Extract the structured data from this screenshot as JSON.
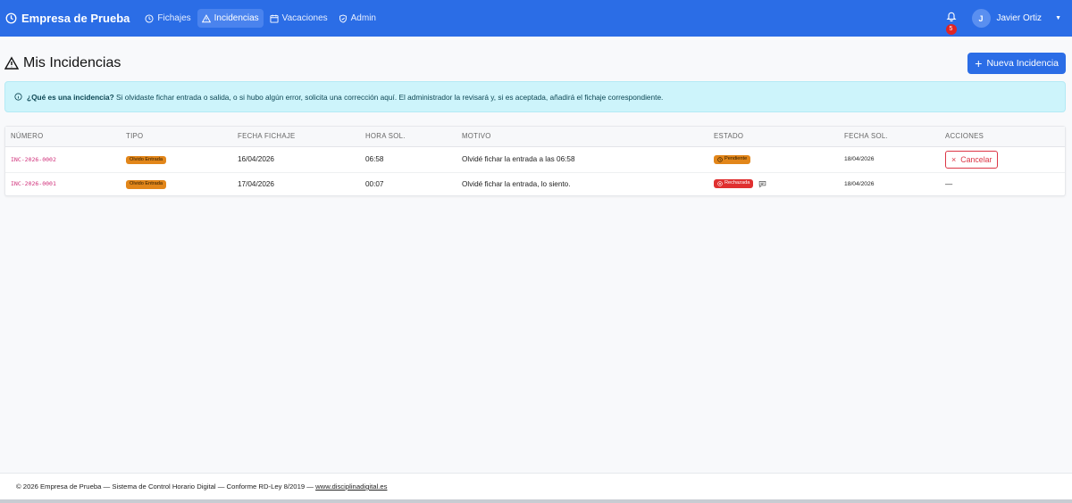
{
  "navbar": {
    "brand": "Empresa de Prueba",
    "items": [
      {
        "label": "Fichajes",
        "icon": "clock-icon",
        "active": false
      },
      {
        "label": "Incidencias",
        "icon": "warning-icon",
        "active": true
      },
      {
        "label": "Vacaciones",
        "icon": "calendar-icon",
        "active": false
      },
      {
        "label": "Admin",
        "icon": "shield-icon",
        "active": false
      }
    ],
    "notifications_count": "5",
    "user": {
      "initial": "J",
      "name": "Javier Ortiz"
    }
  },
  "page": {
    "title": "Mis Incidencias",
    "new_button": "Nueva Incidencia"
  },
  "alert": {
    "bold": "¿Qué es una incidencia?",
    "text": " Si olvidaste fichar entrada o salida, o si hubo algún error, solicita una corrección aquí. El administrador la revisará y, si es aceptada, añadirá el fichaje correspondiente."
  },
  "table": {
    "headers": [
      "NÚMERO",
      "TIPO",
      "FECHA FICHAJE",
      "HORA SOL.",
      "MOTIVO",
      "ESTADO",
      "FECHA SOL.",
      "ACCIONES"
    ],
    "rows": [
      {
        "numero": "INC-2026-0002",
        "tipo": "Olvido Entrada",
        "fecha_fichaje": "16/04/2026",
        "hora": "06:58",
        "motivo": "Olvidé fichar la entrada a las 06:58",
        "estado": "Pendiente",
        "fecha_sol": "18/04/2026",
        "accion": "Cancelar"
      },
      {
        "numero": "INC-2026-0001",
        "tipo": "Olvido Entrada",
        "fecha_fichaje": "17/04/2026",
        "hora": "00:07",
        "motivo": "Olvidé fichar la entrada, lo siento.",
        "estado": "Rechazada",
        "fecha_sol": "18/04/2026",
        "accion": "—"
      }
    ]
  },
  "footer": {
    "text": "© 2026 Empresa de Prueba — Sistema de Control Horario Digital — Conforme RD-Ley 8/2019 — ",
    "link": "www.disciplinadigital.es"
  },
  "colors": {
    "primary": "#2b6de6",
    "pending": "#e2861a",
    "rejected": "#e03030",
    "code": "#d0307a"
  }
}
